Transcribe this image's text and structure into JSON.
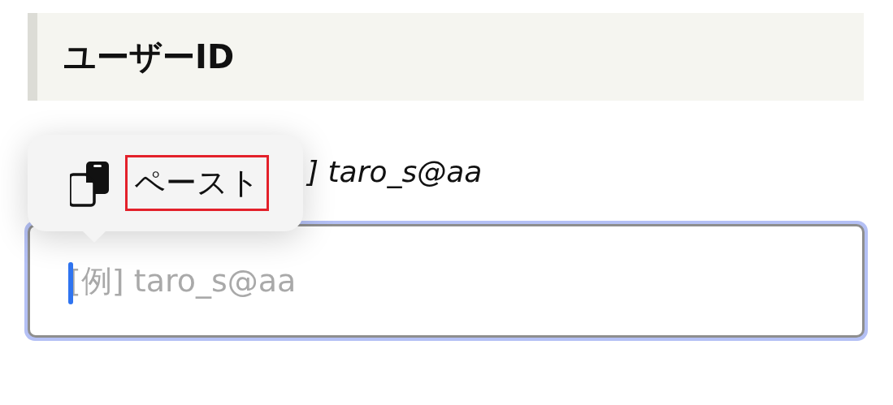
{
  "section": {
    "title": "ユーザーID"
  },
  "hint": {
    "text": "] taro_s@aa"
  },
  "field": {
    "placeholder": "[例] taro_s@aa",
    "focused": true
  },
  "edit_menu": {
    "items": [
      {
        "label": "ペースト",
        "highlighted": true
      }
    ]
  }
}
